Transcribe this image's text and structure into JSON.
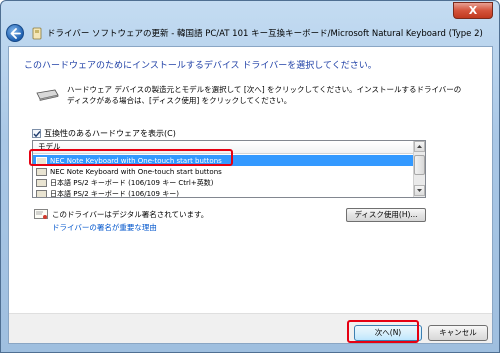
{
  "window": {
    "title": "ドライバー ソフトウェアの更新 - 韓国語 PC/AT 101 キー互換キーボード/Microsoft Natural Keyboard (Type 2)",
    "close_label": "X"
  },
  "heading": "このハードウェアのためにインストールするデバイス ドライバーを選択してください。",
  "instructions": [
    "ハードウェア デバイスの製造元とモデルを選択して [次へ] をクリックしてください。インストールするドライバーの",
    "ディスクがある場合は、[ディスク使用] をクリックしてください。"
  ],
  "compatible_checkbox": {
    "label": "互換性のあるハードウェアを表示(C)",
    "checked": true
  },
  "model_list": {
    "header": "モデル",
    "items": [
      {
        "label": "NEC Note Keyboard with One-touch start buttons",
        "selected": true
      },
      {
        "label": "NEC Note Keyboard with One-touch start buttons",
        "selected": false
      },
      {
        "label": "日本語 PS/2 キーボード (106/109 キー Ctrl+英数)",
        "selected": false
      },
      {
        "label": "日本語 PS/2 キーボード (106/109 キー)",
        "selected": false
      }
    ]
  },
  "signature": {
    "text": "このドライバーはデジタル署名されています。",
    "link": "ドライバーの署名が重要な理由"
  },
  "buttons": {
    "have_disk": "ディスク使用(H)...",
    "next": "次へ(N)",
    "cancel": "キャンセル"
  },
  "colors": {
    "highlight": "#e60012",
    "selection": "#3399ff",
    "heading": "#1e3fa6",
    "link": "#0055cc"
  }
}
